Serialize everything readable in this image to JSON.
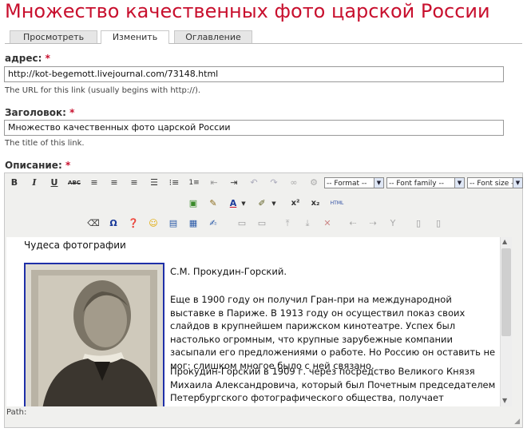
{
  "page": {
    "title": "Множество качественных фото царской России"
  },
  "tabs": [
    {
      "label": "Просмотреть",
      "active": false
    },
    {
      "label": "Изменить",
      "active": true
    },
    {
      "label": "Оглавление",
      "active": false
    }
  ],
  "address": {
    "label": "адрес:",
    "required": "*",
    "value": "http://kot-begemott.livejournal.com/73148.html",
    "help": "The URL for this link (usually begins with http://)."
  },
  "heading_field": {
    "label": "Заголовок:",
    "required": "*",
    "value": "Множество качественных фото царской России",
    "help": "The title of this link."
  },
  "description": {
    "label": "Описание:",
    "required": "*"
  },
  "toolbar": {
    "format_select": "-- Format --",
    "font_family_select": "-- Font family --",
    "font_size_select": "-- Font size --",
    "html_button": "HTML",
    "bold": "B",
    "italic": "I",
    "underline": "U",
    "strike": "ABC"
  },
  "editor_content": {
    "heading": "Чудеса фотографии",
    "author": "С.М. Прокудин-Горский.",
    "paragraph1": "Еще в 1900 году он получил Гран-при на международной выставке в Париже. В 1913 году он осуществил показ своих слайдов в крупнейшем парижском кинотеатре. Успех был настолько огромным, что крупные зарубежные компании засыпали его предложениями о работе. Но Россию он оставить не мог: слишком многое было с ней связано.",
    "paragraph2": "Прокудин-Горский в 1909 г. через посредство Великого Князя Михаила Александровича, который был Почетным председателем Петербургского фотографического общества, получает аудиенцию у"
  },
  "statusbar": {
    "path_label": "Path:"
  },
  "colors": {
    "accent": "#c8102e",
    "frame": "#1f30a8"
  }
}
